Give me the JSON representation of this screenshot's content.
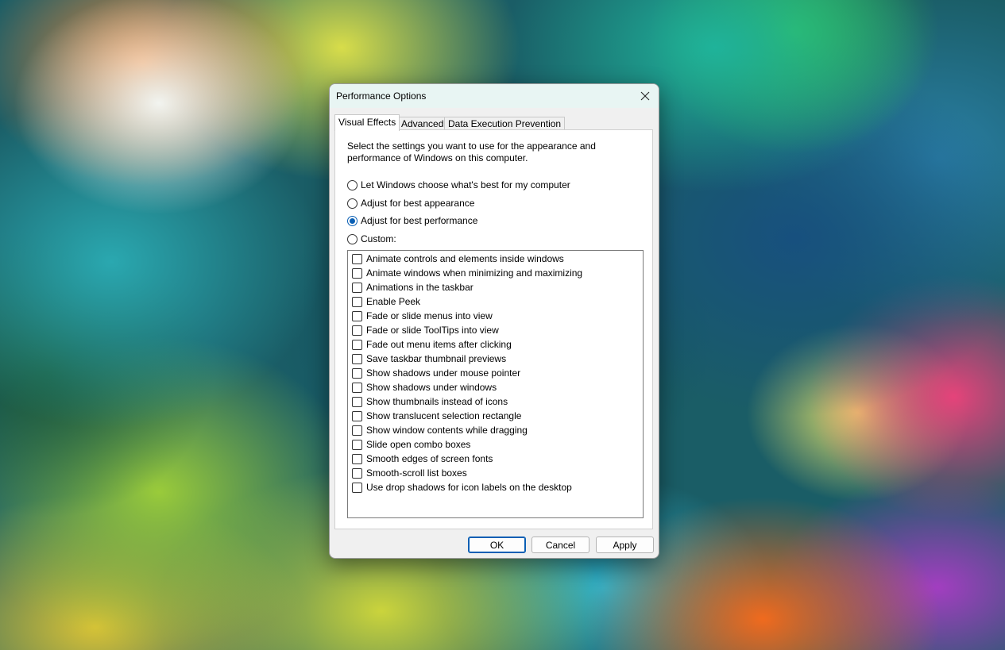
{
  "dialog": {
    "title": "Performance Options",
    "close_icon": "close-icon",
    "tabs": [
      {
        "label": "Visual Effects",
        "active": true
      },
      {
        "label": "Advanced",
        "active": false
      },
      {
        "label": "Data Execution Prevention",
        "active": false
      }
    ],
    "description": "Select the settings you want to use for the appearance and performance of Windows on this computer.",
    "radios": [
      {
        "label": "Let Windows choose what's best for my computer",
        "checked": false
      },
      {
        "label": "Adjust for best appearance",
        "checked": false
      },
      {
        "label": "Adjust for best performance",
        "checked": true
      },
      {
        "label": "Custom:",
        "checked": false
      }
    ],
    "effects": [
      {
        "label": "Animate controls and elements inside windows",
        "checked": false
      },
      {
        "label": "Animate windows when minimizing and maximizing",
        "checked": false
      },
      {
        "label": "Animations in the taskbar",
        "checked": false
      },
      {
        "label": "Enable Peek",
        "checked": false
      },
      {
        "label": "Fade or slide menus into view",
        "checked": false
      },
      {
        "label": "Fade or slide ToolTips into view",
        "checked": false
      },
      {
        "label": "Fade out menu items after clicking",
        "checked": false
      },
      {
        "label": "Save taskbar thumbnail previews",
        "checked": false
      },
      {
        "label": "Show shadows under mouse pointer",
        "checked": false
      },
      {
        "label": "Show shadows under windows",
        "checked": false
      },
      {
        "label": "Show thumbnails instead of icons",
        "checked": false
      },
      {
        "label": "Show translucent selection rectangle",
        "checked": false
      },
      {
        "label": "Show window contents while dragging",
        "checked": false
      },
      {
        "label": "Slide open combo boxes",
        "checked": false
      },
      {
        "label": "Smooth edges of screen fonts",
        "checked": false
      },
      {
        "label": "Smooth-scroll list boxes",
        "checked": false
      },
      {
        "label": "Use drop shadows for icon labels on the desktop",
        "checked": false
      }
    ],
    "buttons": {
      "ok": "OK",
      "cancel": "Cancel",
      "apply": "Apply"
    },
    "colors": {
      "accent": "#0a5fb4",
      "titlebar": "#e8f5f3"
    }
  }
}
